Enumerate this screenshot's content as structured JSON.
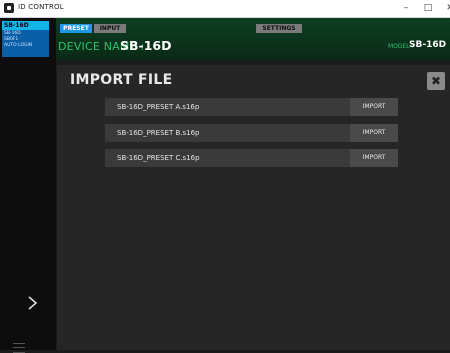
{
  "window": {
    "title": "ID CONTROL",
    "controls": {
      "minimize": "–",
      "maximize": "□",
      "close": "✕"
    }
  },
  "sidebar": {
    "selected_device": "SB-16D",
    "device_info_lines": [
      "SB-16D",
      "SB0F1",
      "AUTO LOGIN"
    ],
    "arrow_icon": "chevron-right-icon",
    "menu_icon": "hamburger-menu-icon"
  },
  "header": {
    "tabs": [
      {
        "label": "PRESET",
        "active": true
      },
      {
        "label": "INPUT",
        "active": false
      },
      {
        "label": "SETTINGS",
        "active": false
      }
    ],
    "device_name_label": "DEVICE NAME :",
    "device_name_value": "SB-16D",
    "model_label": "MODEL :",
    "model_value": "SB-16D"
  },
  "dialog": {
    "title": "IMPORT FILE",
    "close_symbol": "✖",
    "files": [
      {
        "name": "SB-16D_PRESET A.s16p",
        "action": "IMPORT"
      },
      {
        "name": "SB-16D_PRESET B.s16p",
        "action": "IMPORT"
      },
      {
        "name": "SB-16D_PRESET C.s16p",
        "action": "IMPORT"
      }
    ]
  },
  "colors": {
    "accent_blue": "#1a9be0",
    "header_green": "#0e3f22",
    "label_green": "#2ec06a",
    "selected_device": "#0fb5e8"
  }
}
